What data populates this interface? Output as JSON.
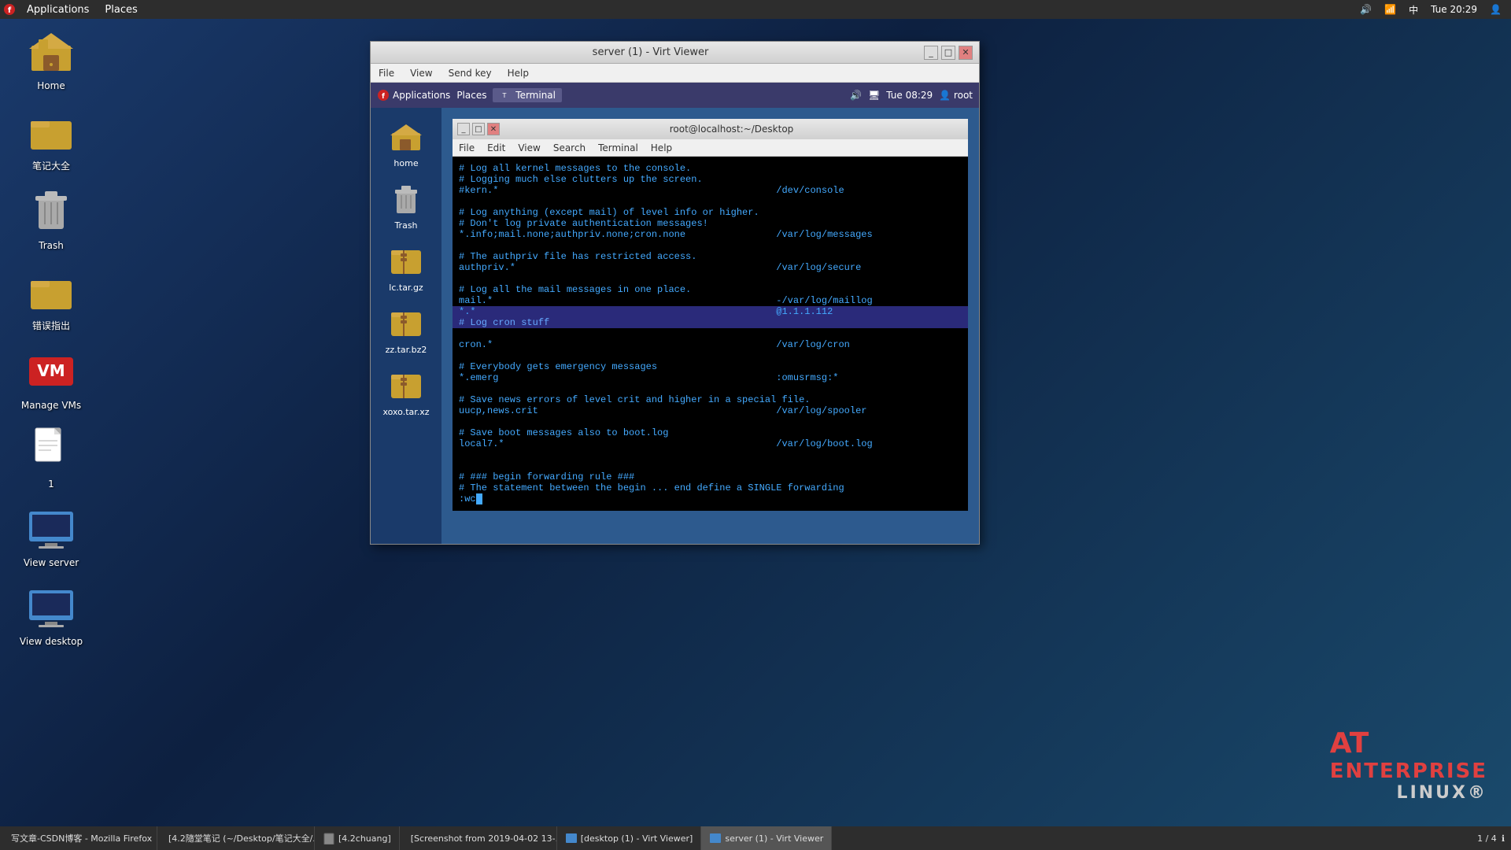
{
  "topbar": {
    "app_label": "Applications",
    "places_label": "Places",
    "time": "Tue 20:29"
  },
  "desktop": {
    "icons": [
      {
        "id": "home",
        "label": "Home",
        "type": "folder-home"
      },
      {
        "id": "notes",
        "label": "笔记大全",
        "type": "folder"
      },
      {
        "id": "trash",
        "label": "Trash",
        "type": "trash"
      },
      {
        "id": "errors",
        "label": "错误指出",
        "type": "folder"
      },
      {
        "id": "manage-vms",
        "label": "Manage VMs",
        "type": "vm"
      },
      {
        "id": "file1",
        "label": "1",
        "type": "text-file"
      },
      {
        "id": "view-server",
        "label": "View server",
        "type": "monitor"
      },
      {
        "id": "view-desktop",
        "label": "View desktop",
        "type": "monitor"
      }
    ]
  },
  "virt_viewer": {
    "title": "server (1) - Virt Viewer",
    "menu_items": [
      "File",
      "View",
      "Send key",
      "Help"
    ],
    "toolbar": {
      "applications": "Applications",
      "places": "Places",
      "terminal": "Terminal",
      "time": "Tue 08:29",
      "user": "root"
    },
    "sidebar": {
      "items": [
        {
          "label": "home",
          "type": "folder-home"
        },
        {
          "label": "Trash",
          "type": "trash"
        },
        {
          "label": "lc.tar.gz",
          "type": "archive"
        },
        {
          "label": "zz.tar.bz2",
          "type": "archive"
        },
        {
          "label": "xoxo.tar.xz",
          "type": "archive"
        }
      ]
    },
    "terminal": {
      "title": "root@localhost:~/Desktop",
      "menu_items": [
        "File",
        "Edit",
        "View",
        "Search",
        "Terminal",
        "Help"
      ],
      "content_lines": [
        {
          "text": "# Log all kernel messages to the console.",
          "type": "comment"
        },
        {
          "text": "# Logging much else clutters up the screen.",
          "type": "comment"
        },
        {
          "text": "#kern.*                                                 /dev/console",
          "type": "comment"
        },
        {
          "text": "",
          "type": "blank"
        },
        {
          "text": "# Log anything (except mail) of level info or higher.",
          "type": "comment"
        },
        {
          "text": "# Don't log private authentication messages!",
          "type": "comment"
        },
        {
          "text": "*.info;mail.none;authpriv.none;cron.none                /var/log/messages",
          "type": "code"
        },
        {
          "text": "",
          "type": "blank"
        },
        {
          "text": "# The authpriv file has restricted access.",
          "type": "comment"
        },
        {
          "text": "authpriv.*                                              /var/log/secure",
          "type": "code"
        },
        {
          "text": "",
          "type": "blank"
        },
        {
          "text": "# Log all the mail messages in one place.",
          "type": "comment"
        },
        {
          "text": "mail.*                                                  -/var/log/maillog",
          "type": "code"
        },
        {
          "text": "",
          "type": "blank"
        },
        {
          "text": "*.*                                                     @1.1.1.112",
          "type": "highlight"
        },
        {
          "text": "# Log cron stuff",
          "type": "highlight-comment"
        },
        {
          "text": "cron.*                                                  /var/log/cron",
          "type": "code"
        },
        {
          "text": "",
          "type": "blank"
        },
        {
          "text": "# Everybody gets emergency messages",
          "type": "comment"
        },
        {
          "text": "*.emerg                                                 :omusrmsg:*",
          "type": "code"
        },
        {
          "text": "",
          "type": "blank"
        },
        {
          "text": "# Save news errors of level crit and higher in a special file.",
          "type": "comment"
        },
        {
          "text": "uucp,news.crit                                          /var/log/spooler",
          "type": "code"
        },
        {
          "text": "",
          "type": "blank"
        },
        {
          "text": "# Save boot messages also to boot.log",
          "type": "comment"
        },
        {
          "text": "local7.*                                                /var/log/boot.log",
          "type": "code"
        },
        {
          "text": "",
          "type": "blank"
        },
        {
          "text": "",
          "type": "blank"
        },
        {
          "text": "# ### begin forwarding rule ###",
          "type": "comment"
        },
        {
          "text": "# The statement between the begin ... end define a SINGLE forwarding",
          "type": "comment"
        },
        {
          "text": ":wc",
          "type": "cmd-cursor"
        }
      ]
    }
  },
  "enterprise": {
    "at": "AT",
    "enterprise": "ENTERPRISE",
    "linux": "LINUX®"
  },
  "taskbar": {
    "items": [
      {
        "label": "写文章-CSDN博客 - Mozilla Firefox",
        "icon": "firefox"
      },
      {
        "label": "[4.2隨堂笔记 (~/Desktop/笔记大全/...",
        "icon": "notes"
      },
      {
        "label": "[4.2chuang]",
        "icon": "notes"
      },
      {
        "label": "[Screenshot from 2019-04-02 13-...",
        "icon": "screenshot"
      },
      {
        "label": "[desktop (1) - Virt Viewer]",
        "icon": "virt"
      },
      {
        "label": "server (1) - Virt Viewer",
        "icon": "virt",
        "active": true
      }
    ],
    "page": "1 / 4"
  }
}
